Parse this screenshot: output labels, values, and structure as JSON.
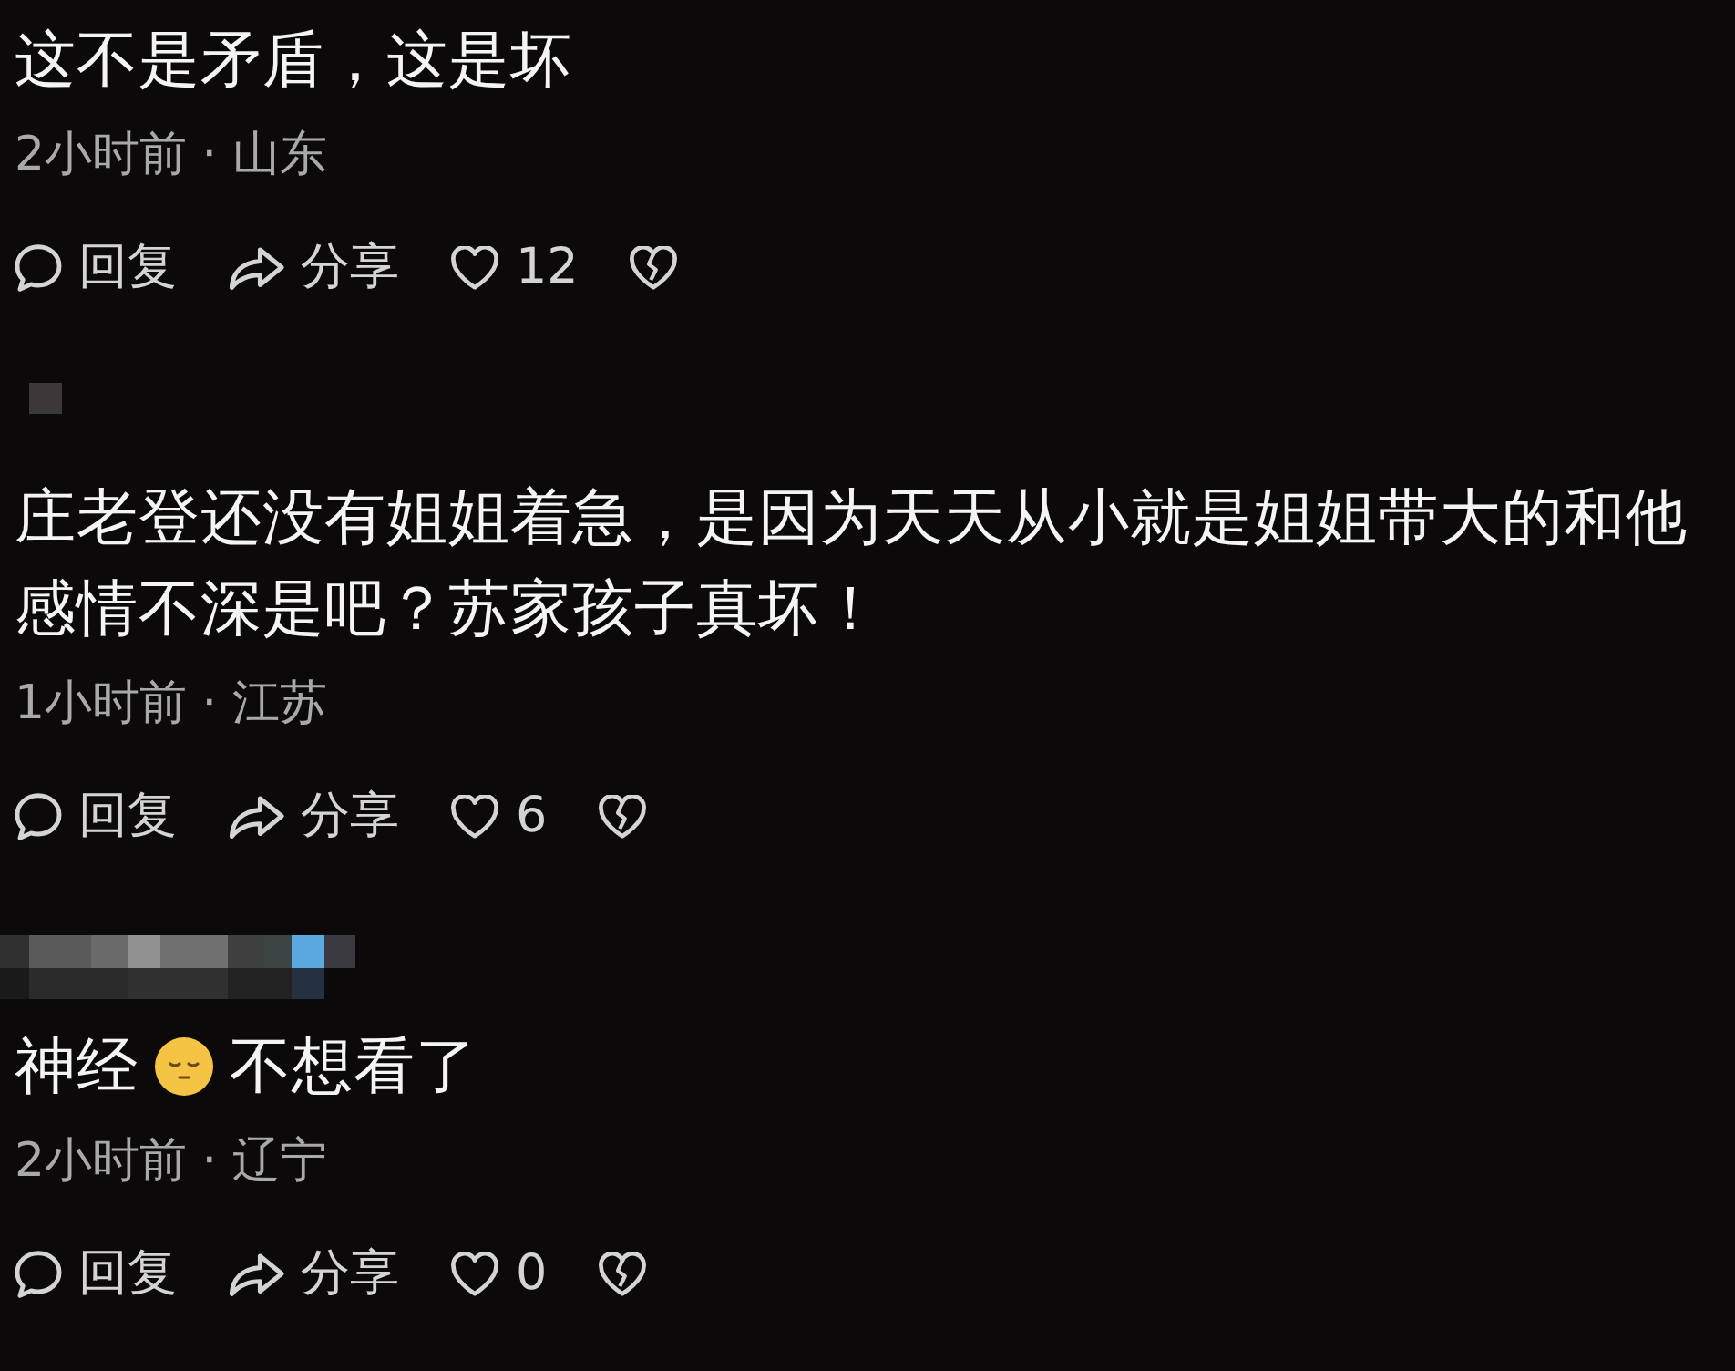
{
  "comments": [
    {
      "content": [
        {
          "kind": "text",
          "text": "这不是矛盾，这是坏"
        }
      ],
      "meta": "2小时前 · 山东",
      "reply": "回复",
      "share": "分享",
      "likes": "12"
    },
    {
      "author": {
        "kind": "tile"
      },
      "content": [
        {
          "kind": "text",
          "text": "庄老登还没有姐姐着急，是因为天天从小就是姐姐带大的和他感情不深是吧？苏家孩子真坏！"
        }
      ],
      "meta": "1小时前 · 江苏",
      "reply": "回复",
      "share": "分享",
      "likes": "6"
    },
    {
      "author": {
        "kind": "strip"
      },
      "content": [
        {
          "kind": "text",
          "text": "神经"
        },
        {
          "kind": "emoji"
        },
        {
          "kind": "text",
          "text": "不想看了"
        }
      ],
      "meta": "2小时前 · 辽宁",
      "reply": "回复",
      "share": "分享",
      "likes": "0"
    }
  ]
}
